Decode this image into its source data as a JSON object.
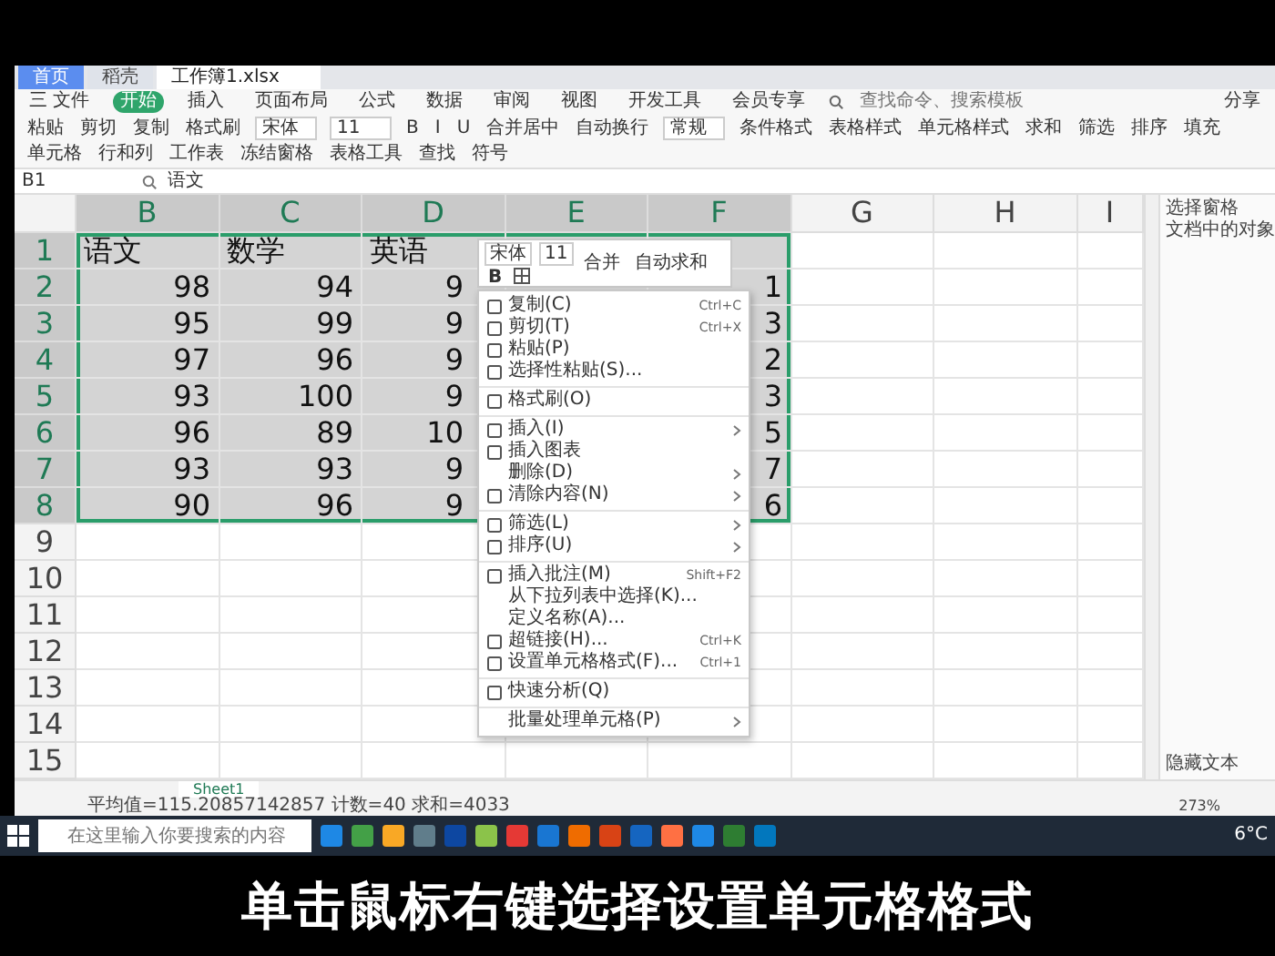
{
  "top_tabs": [
    {
      "label": "首页",
      "selected": false
    },
    {
      "label": "稻壳",
      "selected": false
    },
    {
      "label": "工作簿1.xlsx",
      "selected": true
    }
  ],
  "menu": [
    {
      "label": "三 文件",
      "selected": false
    },
    {
      "label": "开始",
      "selected": true
    },
    {
      "label": "插入",
      "selected": false
    },
    {
      "label": "页面布局",
      "selected": false
    },
    {
      "label": "公式",
      "selected": false
    },
    {
      "label": "数据",
      "selected": false
    },
    {
      "label": "审阅",
      "selected": false
    },
    {
      "label": "视图",
      "selected": false
    },
    {
      "label": "开发工具",
      "selected": false
    },
    {
      "label": "会员专享",
      "selected": false
    }
  ],
  "search": {
    "placeholder": "查找命令、搜索模板"
  },
  "share": "分享",
  "ribbon": [
    {
      "kind": "button",
      "label": "粘贴"
    },
    {
      "kind": "button",
      "label": "剪切"
    },
    {
      "kind": "button",
      "label": "复制"
    },
    {
      "kind": "button",
      "label": "格式刷"
    },
    {
      "kind": "field",
      "label": "宋体"
    },
    {
      "kind": "field",
      "label": "11"
    },
    {
      "kind": "button",
      "label": "B"
    },
    {
      "kind": "button",
      "label": "I"
    },
    {
      "kind": "button",
      "label": "U"
    },
    {
      "kind": "button",
      "label": "合并居中"
    },
    {
      "kind": "button",
      "label": "自动换行"
    },
    {
      "kind": "field",
      "label": "常规"
    },
    {
      "kind": "button",
      "label": "条件格式"
    },
    {
      "kind": "button",
      "label": "表格样式"
    },
    {
      "kind": "button",
      "label": "单元格样式"
    },
    {
      "kind": "button",
      "label": "求和"
    },
    {
      "kind": "button",
      "label": "筛选"
    },
    {
      "kind": "button",
      "label": "排序"
    },
    {
      "kind": "button",
      "label": "填充"
    },
    {
      "kind": "button",
      "label": "单元格"
    },
    {
      "kind": "button",
      "label": "行和列"
    },
    {
      "kind": "button",
      "label": "工作表"
    },
    {
      "kind": "button",
      "label": "冻结窗格"
    },
    {
      "kind": "button",
      "label": "表格工具"
    },
    {
      "kind": "button",
      "label": "查找"
    },
    {
      "kind": "button",
      "label": "符号"
    }
  ],
  "formula_bar": {
    "cell_ref": "B1",
    "value": "语文"
  },
  "columns": [
    {
      "label": "B",
      "selected": true
    },
    {
      "label": "C",
      "selected": true
    },
    {
      "label": "D",
      "selected": true
    },
    {
      "label": "E",
      "selected": true
    },
    {
      "label": "F",
      "selected": true
    },
    {
      "label": "G",
      "selected": false
    },
    {
      "label": "H",
      "selected": false
    },
    {
      "label": "I",
      "selected": false
    }
  ],
  "rows": [
    {
      "label": "1",
      "selected": true,
      "cells": [
        {
          "kind": "text",
          "value": "语文"
        },
        {
          "kind": "text",
          "value": "数学"
        },
        {
          "kind": "text",
          "value": "英语"
        },
        null,
        null
      ]
    },
    {
      "label": "2",
      "selected": true,
      "cells": [
        {
          "kind": "number",
          "value": "98"
        },
        {
          "kind": "number",
          "value": "94"
        },
        {
          "kind": "partial",
          "value": "9"
        },
        null,
        {
          "kind": "number",
          "value": "1"
        }
      ]
    },
    {
      "label": "3",
      "selected": true,
      "cells": [
        {
          "kind": "number",
          "value": "95"
        },
        {
          "kind": "number",
          "value": "99"
        },
        {
          "kind": "partial",
          "value": "9"
        },
        null,
        {
          "kind": "number",
          "value": "3"
        }
      ]
    },
    {
      "label": "4",
      "selected": true,
      "cells": [
        {
          "kind": "number",
          "value": "97"
        },
        {
          "kind": "number",
          "value": "96"
        },
        {
          "kind": "partial",
          "value": "9"
        },
        null,
        {
          "kind": "number",
          "value": "2"
        }
      ]
    },
    {
      "label": "5",
      "selected": true,
      "cells": [
        {
          "kind": "number",
          "value": "93"
        },
        {
          "kind": "number",
          "value": "100"
        },
        {
          "kind": "partial",
          "value": "9"
        },
        null,
        {
          "kind": "number",
          "value": "3"
        }
      ]
    },
    {
      "label": "6",
      "selected": true,
      "cells": [
        {
          "kind": "number",
          "value": "96"
        },
        {
          "kind": "number",
          "value": "89"
        },
        {
          "kind": "partial",
          "value": "10"
        },
        null,
        {
          "kind": "number",
          "value": "5"
        }
      ]
    },
    {
      "label": "7",
      "selected": true,
      "cells": [
        {
          "kind": "number",
          "value": "93"
        },
        {
          "kind": "number",
          "value": "93"
        },
        {
          "kind": "partial",
          "value": "9"
        },
        null,
        {
          "kind": "number",
          "value": "7"
        }
      ]
    },
    {
      "label": "8",
      "selected": true,
      "cells": [
        {
          "kind": "number",
          "value": "90"
        },
        {
          "kind": "number",
          "value": "96"
        },
        {
          "kind": "partial",
          "value": "9"
        },
        null,
        {
          "kind": "number",
          "value": "6"
        }
      ]
    },
    {
      "label": "9",
      "selected": false,
      "cells": []
    },
    {
      "label": "10",
      "selected": false,
      "cells": []
    },
    {
      "label": "11",
      "selected": false,
      "cells": []
    },
    {
      "label": "12",
      "selected": false,
      "cells": []
    },
    {
      "label": "13",
      "selected": false,
      "cells": []
    },
    {
      "label": "14",
      "selected": false,
      "cells": []
    },
    {
      "label": "15",
      "selected": false,
      "cells": []
    }
  ],
  "mini_toolbar": {
    "font": "宋体",
    "size": "11",
    "bold": "B",
    "merge": "合并",
    "autosum": "自动求和"
  },
  "context_menu": [
    {
      "kind": "item",
      "label": "复制(C)",
      "shortcut": "Ctrl+C",
      "icon": true
    },
    {
      "kind": "item",
      "label": "剪切(T)",
      "shortcut": "Ctrl+X",
      "icon": true
    },
    {
      "kind": "item",
      "label": "粘贴(P)",
      "icon": true
    },
    {
      "kind": "item",
      "label": "选择性粘贴(S)...",
      "icon": true
    },
    {
      "kind": "separator"
    },
    {
      "kind": "item",
      "label": "格式刷(O)",
      "icon": true
    },
    {
      "kind": "separator"
    },
    {
      "kind": "item",
      "label": "插入(I)",
      "icon": true,
      "submenu": true
    },
    {
      "kind": "item",
      "label": "插入图表",
      "icon": true
    },
    {
      "kind": "item",
      "label": "删除(D)",
      "submenu": true
    },
    {
      "kind": "item",
      "label": "清除内容(N)",
      "icon": true,
      "submenu": true
    },
    {
      "kind": "separator"
    },
    {
      "kind": "item",
      "label": "筛选(L)",
      "icon": true,
      "submenu": true
    },
    {
      "kind": "item",
      "label": "排序(U)",
      "icon": true,
      "submenu": true
    },
    {
      "kind": "separator"
    },
    {
      "kind": "item",
      "label": "插入批注(M)",
      "shortcut": "Shift+F2",
      "icon": true
    },
    {
      "kind": "item",
      "label": "从下拉列表中选择(K)..."
    },
    {
      "kind": "item",
      "label": "定义名称(A)..."
    },
    {
      "kind": "item",
      "label": "超链接(H)...",
      "shortcut": "Ctrl+K",
      "icon": true
    },
    {
      "kind": "item",
      "label": "设置单元格格式(F)...",
      "shortcut": "Ctrl+1",
      "icon": true
    },
    {
      "kind": "separator"
    },
    {
      "kind": "item",
      "label": "快速分析(Q)",
      "icon": true
    },
    {
      "kind": "separator"
    },
    {
      "kind": "item",
      "label": "批量处理单元格(P)",
      "submenu": true
    }
  ],
  "side_pane": {
    "title": "选择窗格",
    "subtitle": "文档中的对象",
    "footer": "隐藏文本"
  },
  "sheet_tabs": [
    {
      "label": "Sheet1",
      "selected": true
    }
  ],
  "status_bar": {
    "summary": "平均值=115.20857142857 计数=40 求和=4033",
    "zoom": "273%"
  },
  "taskbar": {
    "search_placeholder": "在这里输入你要搜索的内容",
    "weather": "6°C",
    "apps": [
      {
        "color": "#1e88e5"
      },
      {
        "color": "#43a047"
      },
      {
        "color": "#f9a825"
      },
      {
        "color": "#607d8b"
      },
      {
        "color": "#0d47a1"
      },
      {
        "color": "#8bc34a"
      },
      {
        "color": "#e53935"
      },
      {
        "color": "#1976d2"
      },
      {
        "color": "#ef6c00"
      },
      {
        "color": "#d84315"
      },
      {
        "color": "#1565c0"
      },
      {
        "color": "#ff7043"
      },
      {
        "color": "#1e88e5"
      },
      {
        "color": "#2e7d32"
      },
      {
        "color": "#0277bd"
      }
    ]
  },
  "caption": "单击鼠标右键选择设置单元格格式"
}
